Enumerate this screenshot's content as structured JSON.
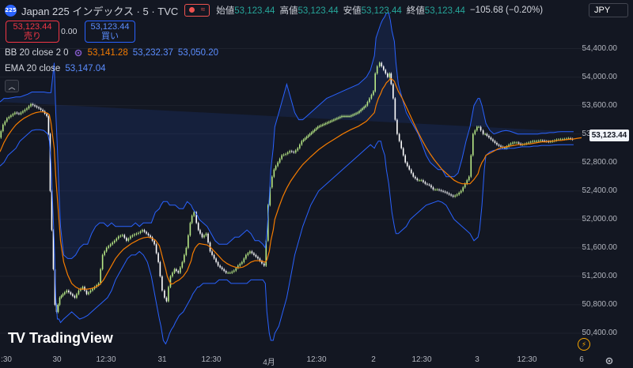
{
  "header": {
    "symbol_badge": "225",
    "title": "Japan 225 インデックス · 5 · TVC",
    "ohlc": {
      "open_label": "始値",
      "open": "53,123.44",
      "high_label": "高値",
      "high": "53,123.44",
      "low_label": "安値",
      "low": "53,123.44",
      "close_label": "終値",
      "close": "53,123.44",
      "change": "−105.68 (−0.20%)"
    }
  },
  "trade": {
    "sell_price": "53,123.44",
    "sell_label": "売り",
    "spread": "0.00",
    "buy_price": "53,123.44",
    "buy_label": "買い"
  },
  "indicators": {
    "bb": {
      "name": "BB 20 close 2 0",
      "middle": "53,141.28",
      "upper": "53,232.37",
      "lower": "53,050.20"
    },
    "ema": {
      "name": "EMA 20 close",
      "value": "53,147.04"
    }
  },
  "currency": "JPY",
  "last_price_tag": "53,123.44",
  "price_axis": [
    "54,400.00",
    "54,000.00",
    "53,600.00",
    "53,200.00",
    "52,800.00",
    "52,400.00",
    "52,000.00",
    "51,600.00",
    "51,200.00",
    "50,800.00",
    "50,400.00"
  ],
  "time_axis": [
    ":30",
    "30",
    "12:30",
    "31",
    "12:30",
    "4月",
    "12:30",
    "2",
    "12:30",
    "3",
    "12:30",
    "6"
  ],
  "logo_text": "TradingView",
  "colors": {
    "background": "#131722",
    "bb_band": "#2962ff",
    "ema": "#f57c00",
    "bb_middle": "#ef6c00",
    "candle_up": "#b8e986",
    "candle_down": "#ffffff"
  },
  "chart_data": {
    "type": "line",
    "x": [
      0,
      5,
      10,
      15,
      20,
      25,
      30,
      35,
      40,
      45,
      50,
      55,
      60,
      62,
      64,
      68,
      70,
      72,
      74,
      76,
      80,
      85,
      90,
      95,
      100,
      105,
      110,
      115,
      120,
      125,
      130,
      135,
      140,
      145,
      150,
      155,
      160,
      165,
      170,
      175,
      180,
      185,
      190,
      195,
      200,
      202,
      205,
      208,
      210,
      213,
      215,
      218,
      220,
      225,
      230,
      235,
      240,
      242,
      245,
      248,
      250,
      255,
      260,
      265,
      270,
      275,
      280,
      285,
      290,
      295,
      300,
      305,
      310,
      315,
      320,
      325,
      330,
      333,
      335,
      338,
      340,
      343,
      345,
      350,
      355,
      360,
      365,
      370,
      375,
      380,
      390,
      400,
      410,
      420,
      430,
      440,
      450,
      460,
      465,
      470,
      472,
      475,
      478,
      480,
      483,
      485,
      488,
      490,
      492,
      495,
      497,
      500,
      505,
      510,
      515,
      520,
      525,
      530,
      535,
      540,
      545,
      550,
      555,
      560,
      565,
      570,
      575,
      580,
      585,
      590,
      595,
      600,
      602,
      605,
      608,
      610,
      615,
      620,
      625,
      630,
      635,
      640,
      645,
      650,
      655,
      660,
      665,
      670,
      675,
      680,
      685,
      690,
      695,
      700,
      705,
      710,
      715,
      720,
      725,
      730,
      735
    ],
    "series": [
      {
        "name": "Japan 225",
        "values": [
          53150,
          53330,
          53420,
          53460,
          53500,
          53480,
          53520,
          53560,
          53620,
          53590,
          53560,
          53520,
          53450,
          53200,
          52400,
          51300,
          50800,
          50700,
          50800,
          50900,
          50950,
          51000,
          50950,
          50900,
          51000,
          51050,
          50950,
          51000,
          51050,
          51100,
          51500,
          51600,
          51650,
          51700,
          51760,
          51780,
          51700,
          51760,
          51790,
          51810,
          51850,
          51800,
          51750,
          51650,
          51400,
          51200,
          51000,
          50900,
          50850,
          51050,
          51200,
          51250,
          51300,
          51250,
          51400,
          51600,
          51950,
          52050,
          52100,
          51950,
          51850,
          51750,
          51800,
          51550,
          51450,
          51350,
          51300,
          51250,
          51250,
          51280,
          51350,
          51400,
          51500,
          51550,
          51500,
          51450,
          51380,
          51350,
          51700,
          52200,
          52450,
          52600,
          52700,
          52800,
          52900,
          52920,
          52960,
          52940,
          53000,
          53100,
          53200,
          53300,
          53350,
          53400,
          53450,
          53450,
          53500,
          53600,
          53700,
          53800,
          54050,
          54150,
          54200,
          54150,
          54100,
          54050,
          54000,
          54050,
          53900,
          53700,
          53400,
          53200,
          53000,
          52800,
          52700,
          52600,
          52550,
          52550,
          52500,
          52480,
          52420,
          52420,
          52400,
          52380,
          52350,
          52320,
          52350,
          52400,
          52500,
          52600,
          53200,
          53300,
          53300,
          53250,
          53200,
          53200,
          53150,
          53100,
          53050,
          53020,
          53000,
          53050,
          53080,
          53080,
          53050,
          53060,
          53080,
          53100,
          53100,
          53110,
          53100,
          53090,
          53100,
          53120,
          53125,
          53130,
          53140,
          53123
        ]
      },
      {
        "name": "EMA 20 close",
        "values": [
          52950,
          53080,
          53180,
          53260,
          53330,
          53380,
          53420,
          53450,
          53480,
          53500,
          53510,
          53510,
          53490,
          53470,
          53360,
          53000,
          52600,
          52300,
          52000,
          51700,
          51400,
          51220,
          51100,
          51050,
          51020,
          51020,
          51020,
          51030,
          51050,
          51080,
          51150,
          51250,
          51350,
          51450,
          51520,
          51580,
          51620,
          51660,
          51690,
          51720,
          51740,
          51750,
          51740,
          51710,
          51630,
          51550,
          51420,
          51300,
          51200,
          51120,
          51090,
          51100,
          51120,
          51150,
          51200,
          51280,
          51420,
          51520,
          51600,
          51640,
          51660,
          51650,
          51640,
          51600,
          51540,
          51480,
          51420,
          51380,
          51350,
          51330,
          51320,
          51330,
          51360,
          51400,
          51420,
          51420,
          51410,
          51400,
          51430,
          51550,
          51700,
          51850,
          52000,
          52170,
          52320,
          52440,
          52540,
          52620,
          52700,
          52770,
          52880,
          52980,
          53060,
          53130,
          53200,
          53260,
          53310,
          53380,
          53440,
          53500,
          53600,
          53700,
          53770,
          53830,
          53880,
          53920,
          53950,
          53980,
          53970,
          53940,
          53880,
          53800,
          53700,
          53580,
          53460,
          53340,
          53220,
          53110,
          53010,
          52920,
          52840,
          52770,
          52700,
          52650,
          52600,
          52550,
          52520,
          52500,
          52500,
          52500,
          52560,
          52640,
          52720,
          52800,
          52850,
          52900,
          52930,
          52960,
          52990,
          53010,
          53020,
          53030,
          53040,
          53050,
          53050,
          53060,
          53060,
          53070,
          53080,
          53090,
          53090,
          53100,
          53100,
          53110,
          53110,
          53120,
          53125,
          53130,
          53140,
          53147
        ]
      },
      {
        "name": "BB upper",
        "values": [
          53650,
          53700,
          53700,
          53710,
          53720,
          53720,
          53740,
          53760,
          53790,
          53790,
          53790,
          53790,
          53780,
          53780,
          53780,
          54200,
          53500,
          53000,
          52400,
          51900,
          51500,
          51450,
          51450,
          51500,
          51600,
          51650,
          51650,
          51800,
          51900,
          51950,
          51950,
          51900,
          51950,
          51900,
          51900,
          51900,
          51900,
          51900,
          51950,
          51900,
          51950,
          51950,
          51950,
          52100,
          52150,
          52200,
          52250,
          52250,
          52250,
          52200,
          52200,
          52200,
          52200,
          52150,
          52150,
          52250,
          52200,
          52150,
          52100,
          52050,
          52000,
          51950,
          51900,
          51800,
          51700,
          51650,
          51650,
          51650,
          51700,
          51750,
          51750,
          51800,
          51850,
          51800,
          51700,
          51700,
          51650,
          51600,
          51800,
          52300,
          52700,
          53000,
          53300,
          53500,
          53700,
          53900,
          53700,
          53500,
          53400,
          53400,
          53500,
          53600,
          53700,
          53750,
          53800,
          53850,
          53900,
          54000,
          54100,
          54300,
          54550,
          54650,
          54750,
          54800,
          54850,
          54900,
          54900,
          54800,
          54650,
          54500,
          54200,
          53900,
          53700,
          53500,
          53400,
          53300,
          53200,
          53050,
          52900,
          52800,
          52750,
          52700,
          52700,
          52600,
          52600,
          52600,
          52650,
          52850,
          53100,
          53300,
          53600,
          53700,
          53700,
          53600,
          53450,
          53350,
          53250,
          53200,
          53220,
          53240,
          53250,
          53240,
          53220,
          53200,
          53200,
          53200,
          53200,
          53200,
          53200,
          53210,
          53210,
          53220,
          53220,
          53230,
          53232,
          53232,
          53232,
          53232
        ]
      },
      {
        "name": "BB lower",
        "values": [
          52750,
          52800,
          52900,
          52950,
          53000,
          53100,
          53150,
          53200,
          53250,
          53260,
          53260,
          53250,
          53200,
          53100,
          52800,
          51700,
          50900,
          50600,
          50600,
          50550,
          50600,
          50650,
          50700,
          50650,
          50600,
          50620,
          50650,
          50700,
          50750,
          50800,
          50850,
          50900,
          51000,
          51150,
          51250,
          51350,
          51450,
          51500,
          51500,
          51550,
          51500,
          51400,
          51200,
          50900,
          50600,
          50500,
          50300,
          50250,
          50300,
          50400,
          50450,
          50500,
          50550,
          50650,
          50700,
          50800,
          50900,
          50950,
          51000,
          51050,
          51050,
          51100,
          51100,
          51100,
          51100,
          51150,
          51150,
          51150,
          51100,
          51100,
          51100,
          51100,
          51100,
          51150,
          51150,
          51150,
          51150,
          51100,
          50700,
          50400,
          50300,
          50300,
          50400,
          50500,
          50700,
          50900,
          51200,
          51500,
          51700,
          51900,
          52200,
          52400,
          52500,
          52600,
          52700,
          52800,
          52900,
          53000,
          53050,
          53000,
          53050,
          53100,
          53100,
          53000,
          52900,
          52700,
          52500,
          52300,
          52100,
          51900,
          51800,
          51800,
          51850,
          51900,
          52000,
          52050,
          52100,
          52150,
          52200,
          52220,
          52240,
          52260,
          52240,
          52200,
          52100,
          52000,
          51950,
          51900,
          51850,
          51800,
          51700,
          51750,
          51850,
          52200,
          52700,
          52900,
          52950,
          52970,
          52980,
          52990,
          52990,
          53000,
          53000,
          53010,
          53020,
          53020,
          53020,
          53030,
          53030,
          53040,
          53040,
          53040,
          53045,
          53048,
          53050,
          53050,
          53050,
          53050
        ]
      }
    ],
    "ylim": [
      50200,
      54750
    ],
    "y_ticks": [
      54400,
      54000,
      53600,
      53200,
      52800,
      52400,
      52000,
      51600,
      51200,
      50800,
      50400
    ],
    "grid": false,
    "legend": "top-left"
  }
}
